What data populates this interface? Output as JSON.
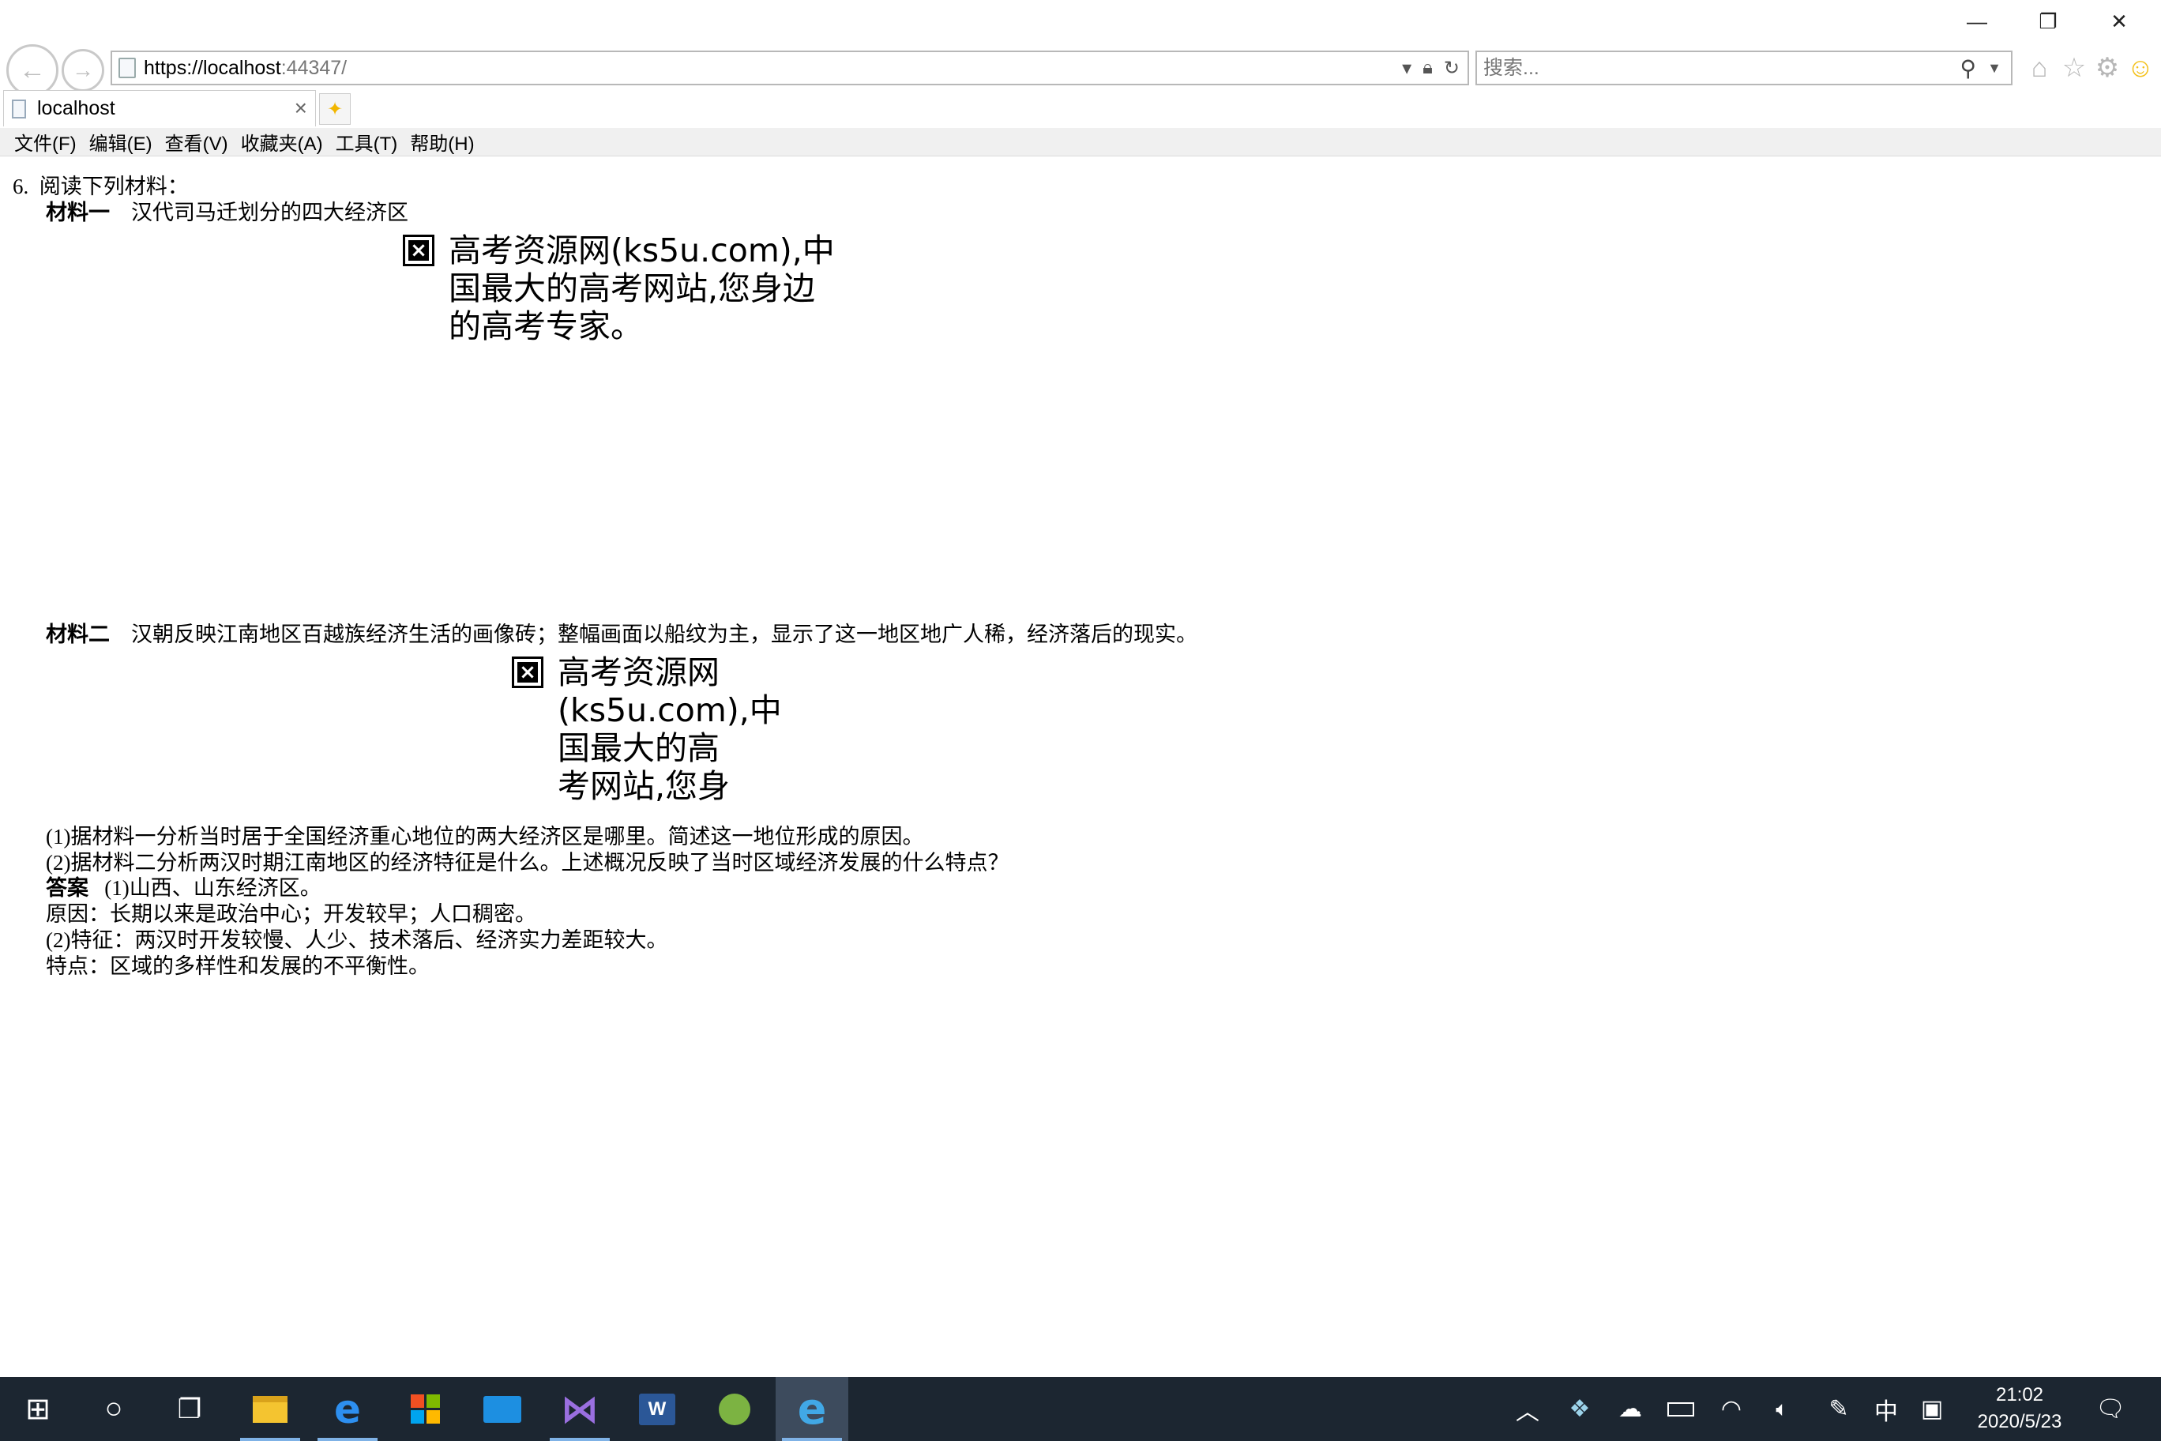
{
  "window": {
    "controls": {
      "minimize": "—",
      "maximize": "❐",
      "close": "✕"
    }
  },
  "address_bar": {
    "url_host": "https://localhost",
    "url_port": ":44347/",
    "icons": [
      "dropdown-arrow",
      "lock-icon",
      "refresh-icon"
    ]
  },
  "search": {
    "placeholder": "搜索..."
  },
  "tabs": [
    {
      "title": "localhost"
    }
  ],
  "menu": [
    "文件(F)",
    "编辑(E)",
    "查看(V)",
    "收藏夹(A)",
    "工具(T)",
    "帮助(H)"
  ],
  "content": {
    "q_number": "6.",
    "intro": "阅读下列材料：",
    "m1_label": "材料一",
    "m1_text": "汉代司马迁划分的四大经济区",
    "image1_lines": [
      "高考资源网(ks5u.com),中",
      "国最大的高考网站,您身边",
      "的高考专家。"
    ],
    "m2_label": "材料二",
    "m2_text": "汉朝反映江南地区百越族经济生活的画像砖；整幅画面以船纹为主，显示了这一地区地广人稀，经济落后的现实。",
    "image2_lines": [
      "高考资源网",
      "(ks5u.com),中",
      "国最大的高",
      "考网站,您身"
    ],
    "question1": "(1)据材料一分析当时居于全国经济重心地位的两大经济区是哪里。简述这一地位形成的原因。",
    "question2": "(2)据材料二分析两汉时期江南地区的经济特征是什么。上述概况反映了当时区域经济发展的什么特点？",
    "answer_label": "答案",
    "answer1": "(1)山西、山东经济区。",
    "reason": "原因：长期以来是政治中心；开发较早；人口稠密。",
    "answer2": "(2)特征：两汉时开发较慢、人少、技术落后、经济实力差距较大。",
    "feature": "特点：区域的多样性和发展的不平衡性。"
  },
  "taskbar": {
    "apps": [
      "start-icon",
      "cortana-icon",
      "task-view-icon",
      "file-explorer-icon",
      "edge-icon",
      "store-icon",
      "mail-icon",
      "visual-studio-icon",
      "word-icon",
      "android-studio-icon",
      "internet-explorer-icon"
    ],
    "ime": "中",
    "time": "21:02",
    "date": "2020/5/23"
  }
}
